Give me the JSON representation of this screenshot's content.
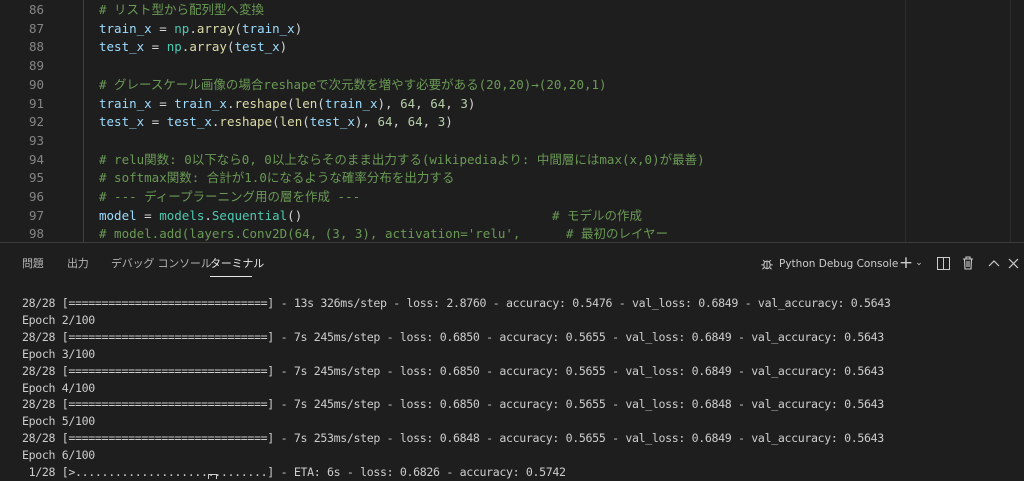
{
  "editor": {
    "line_numbers": [
      "86",
      "87",
      "88",
      "89",
      "90",
      "91",
      "92",
      "93",
      "94",
      "95",
      "96",
      "97",
      "98"
    ],
    "lines": [
      {
        "parts": [
          {
            "t": "# リスト型から配列型へ変換",
            "c": "c-cmt"
          }
        ]
      },
      {
        "parts": [
          {
            "t": "train_x",
            "c": "c-var"
          },
          {
            "t": " = ",
            "c": "c-op"
          },
          {
            "t": "np",
            "c": "c-mod"
          },
          {
            "t": ".",
            "c": "c-op"
          },
          {
            "t": "array",
            "c": "c-fn"
          },
          {
            "t": "(",
            "c": "c-op"
          },
          {
            "t": "train_x",
            "c": "c-var"
          },
          {
            "t": ")",
            "c": "c-op"
          }
        ]
      },
      {
        "parts": [
          {
            "t": "test_x",
            "c": "c-var"
          },
          {
            "t": " = ",
            "c": "c-op"
          },
          {
            "t": "np",
            "c": "c-mod"
          },
          {
            "t": ".",
            "c": "c-op"
          },
          {
            "t": "array",
            "c": "c-fn"
          },
          {
            "t": "(",
            "c": "c-op"
          },
          {
            "t": "test_x",
            "c": "c-var"
          },
          {
            "t": ")",
            "c": "c-op"
          }
        ]
      },
      {
        "parts": []
      },
      {
        "parts": [
          {
            "t": "# グレースケール画像の場合reshapeで次元数を増やす必要がある(20,20)→(20,20,1)",
            "c": "c-cmt"
          }
        ]
      },
      {
        "parts": [
          {
            "t": "train_x",
            "c": "c-var"
          },
          {
            "t": " = ",
            "c": "c-op"
          },
          {
            "t": "train_x",
            "c": "c-var"
          },
          {
            "t": ".",
            "c": "c-op"
          },
          {
            "t": "reshape",
            "c": "c-fn"
          },
          {
            "t": "(",
            "c": "c-op"
          },
          {
            "t": "len",
            "c": "c-fn"
          },
          {
            "t": "(",
            "c": "c-op"
          },
          {
            "t": "train_x",
            "c": "c-var"
          },
          {
            "t": "), ",
            "c": "c-op"
          },
          {
            "t": "64",
            "c": "c-num"
          },
          {
            "t": ", ",
            "c": "c-op"
          },
          {
            "t": "64",
            "c": "c-num"
          },
          {
            "t": ", ",
            "c": "c-op"
          },
          {
            "t": "3",
            "c": "c-num"
          },
          {
            "t": ")",
            "c": "c-op"
          }
        ]
      },
      {
        "parts": [
          {
            "t": "test_x",
            "c": "c-var"
          },
          {
            "t": " = ",
            "c": "c-op"
          },
          {
            "t": "test_x",
            "c": "c-var"
          },
          {
            "t": ".",
            "c": "c-op"
          },
          {
            "t": "reshape",
            "c": "c-fn"
          },
          {
            "t": "(",
            "c": "c-op"
          },
          {
            "t": "len",
            "c": "c-fn"
          },
          {
            "t": "(",
            "c": "c-op"
          },
          {
            "t": "test_x",
            "c": "c-var"
          },
          {
            "t": "), ",
            "c": "c-op"
          },
          {
            "t": "64",
            "c": "c-num"
          },
          {
            "t": ", ",
            "c": "c-op"
          },
          {
            "t": "64",
            "c": "c-num"
          },
          {
            "t": ", ",
            "c": "c-op"
          },
          {
            "t": "3",
            "c": "c-num"
          },
          {
            "t": ")",
            "c": "c-op"
          }
        ]
      },
      {
        "parts": []
      },
      {
        "parts": [
          {
            "t": "# relu関数: 0以下なら0, 0以上ならそのまま出力する(wikipediaより: 中間層にはmax(x,0)が最善)",
            "c": "c-cmt"
          }
        ]
      },
      {
        "parts": [
          {
            "t": "# softmax関数: 合計が1.0になるような確率分布を出力する",
            "c": "c-cmt"
          }
        ]
      },
      {
        "parts": [
          {
            "t": "# --- ディープラーニング用の層を作成 ---",
            "c": "c-cmt"
          }
        ]
      },
      {
        "parts": [
          {
            "t": "model",
            "c": "c-var"
          },
          {
            "t": " = ",
            "c": "c-op"
          },
          {
            "t": "models",
            "c": "c-mod"
          },
          {
            "t": ".",
            "c": "c-op"
          },
          {
            "t": "Sequential",
            "c": "c-mod"
          },
          {
            "t": "()",
            "c": "c-op"
          }
        ],
        "tail": {
          "t": "# モデルの作成",
          "c": "c-cmt"
        }
      },
      {
        "parts": [
          {
            "t": "# model.add(layers.Conv2D(64, (3, 3), activation='relu',",
            "c": "c-cmt"
          }
        ],
        "tail": {
          "t": "# 最初のレイヤー",
          "c": "c-cmt"
        }
      }
    ]
  },
  "panel": {
    "tabs": [
      "問題",
      "出力",
      "デバッグ コンソール",
      "ターミナル"
    ],
    "active_tab": "ターミナル",
    "console_label": "Python Debug Console",
    "icons": [
      "debug-icon",
      "add-icon",
      "chevron-down-icon",
      "split-icon",
      "trash-icon",
      "maximize-icon",
      "close-icon"
    ]
  },
  "terminal": {
    "lines": [
      "28/28 [==============================] - 13s 326ms/step - loss: 2.8760 - accuracy: 0.5476 - val_loss: 0.6849 - val_accuracy: 0.5643",
      "Epoch 2/100",
      "28/28 [==============================] - 7s 245ms/step - loss: 0.6850 - accuracy: 0.5655 - val_loss: 0.6849 - val_accuracy: 0.5643",
      "Epoch 3/100",
      "28/28 [==============================] - 7s 245ms/step - loss: 0.6850 - accuracy: 0.5655 - val_loss: 0.6849 - val_accuracy: 0.5643",
      "Epoch 4/100",
      "28/28 [==============================] - 7s 245ms/step - loss: 0.6850 - accuracy: 0.5655 - val_loss: 0.6848 - val_accuracy: 0.5643",
      "Epoch 5/100",
      "28/28 [==============================] - 7s 253ms/step - loss: 0.6848 - accuracy: 0.5655 - val_loss: 0.6849 - val_accuracy: 0.5643",
      "Epoch 6/100",
      " 1/28 [>.............................] - ETA: 6s - loss: 0.6826 - accuracy: 0.5742"
    ]
  }
}
